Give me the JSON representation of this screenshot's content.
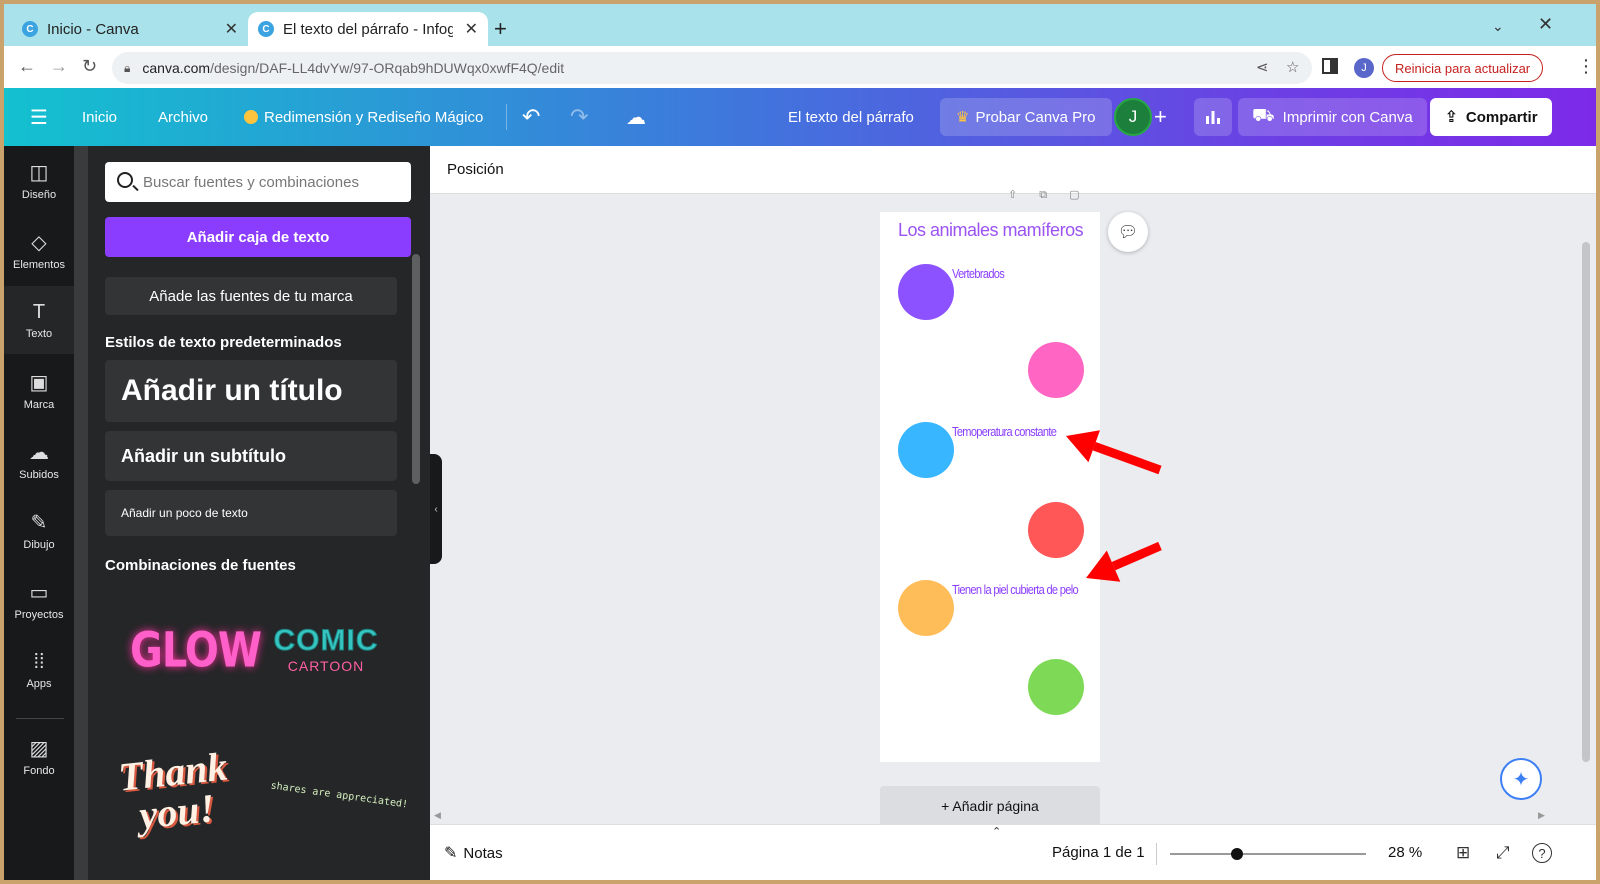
{
  "browser": {
    "tabs": [
      {
        "title": "Inicio - Canva",
        "favicon": "C"
      },
      {
        "title": "El texto del párrafo - Infog",
        "favicon": "C"
      }
    ],
    "new_tab": "+",
    "url_domain": "canva.com",
    "url_path": "/design/DAF-LL4dvYw/97-ORqab9hDUWqx0xwfF4Q/edit",
    "profile_initial": "J",
    "restart_label": "Reinicia para actualizar"
  },
  "header": {
    "inicio": "Inicio",
    "archivo": "Archivo",
    "magic": "Redimensión y Rediseño Mágico",
    "doc_title": "El texto del párrafo",
    "pro": "Probar Canva Pro",
    "avatar": "J",
    "print": "Imprimir con Canva",
    "share": "Compartir"
  },
  "rail": [
    {
      "label": "Diseño",
      "icon": "layout-icon"
    },
    {
      "label": "Elementos",
      "icon": "shapes-icon"
    },
    {
      "label": "Texto",
      "icon": "text-icon"
    },
    {
      "label": "Marca",
      "icon": "brand-icon"
    },
    {
      "label": "Subidos",
      "icon": "upload-icon"
    },
    {
      "label": "Dibujo",
      "icon": "draw-icon"
    },
    {
      "label": "Proyectos",
      "icon": "folder-icon"
    },
    {
      "label": "Apps",
      "icon": "apps-icon"
    },
    {
      "label": "Fondo",
      "icon": "background-icon"
    }
  ],
  "panel": {
    "search_placeholder": "Buscar fuentes y combinaciones",
    "add_textbox": "Añadir caja de texto",
    "brand_fonts": "Añade las fuentes de tu marca",
    "default_styles_heading": "Estilos de texto predeterminados",
    "add_title": "Añadir un título",
    "add_subtitle": "Añadir un subtítulo",
    "add_body": "Añadir un poco de texto",
    "combos_heading": "Combinaciones de fuentes",
    "combos": {
      "glow": "GLOW",
      "comic1": "COMIC",
      "comic2": "CARTOON",
      "thanks": "Thank you!",
      "shares": "shares are appreciated!"
    }
  },
  "workspace": {
    "position_btn": "Posición",
    "page": {
      "title": "Los animales mamíferos",
      "labels": [
        "Vertebrados",
        "Temoperatura constante",
        "Tienen la piel cubierta de pelo"
      ],
      "circle_colors": [
        "#8c52ff",
        "#ff66c4",
        "#38b6ff",
        "#ff5757",
        "#ffbd59",
        "#7ed957"
      ]
    },
    "annotation_color": "#ff0000",
    "add_page": "+ Añadir página",
    "notes": "Notas",
    "page_indicator": "Página 1 de 1",
    "zoom": "28 %",
    "zoom_fraction": 0.28
  }
}
